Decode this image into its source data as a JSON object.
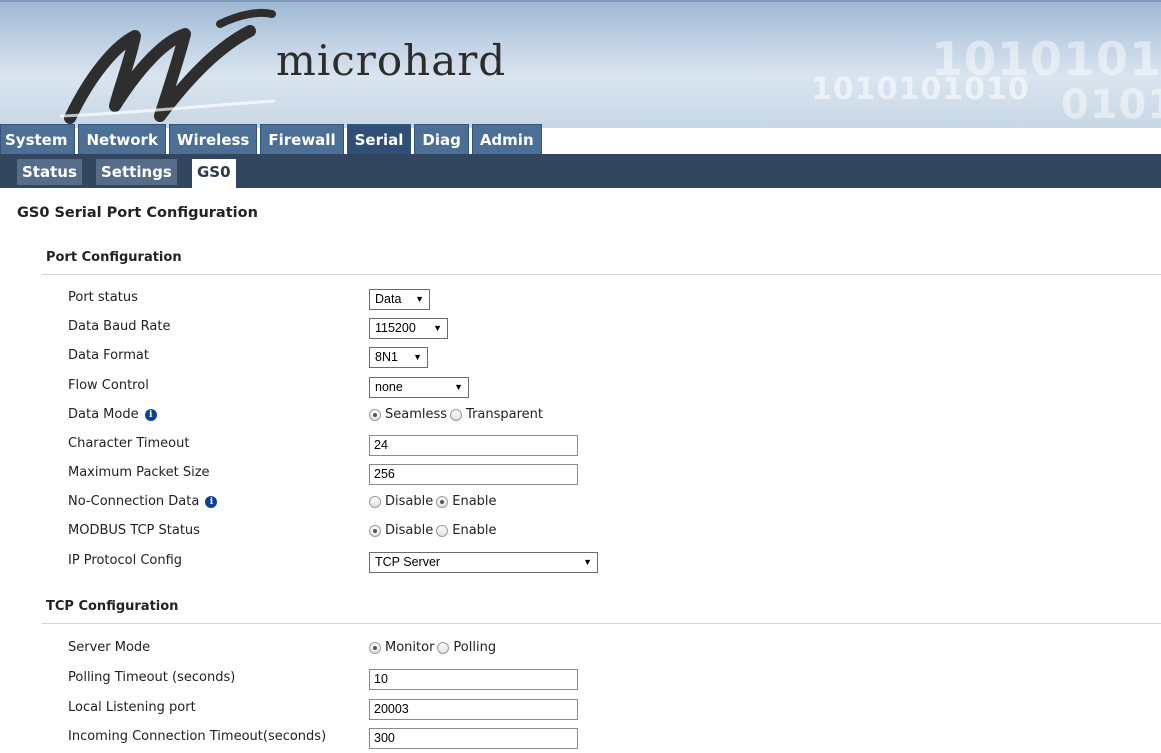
{
  "brand": {
    "name": "microhard",
    "binary_deco": [
      "1010101010",
      "1010101",
      "0101"
    ]
  },
  "main_tabs": [
    "System",
    "Network",
    "Wireless",
    "Firewall",
    "Serial",
    "Diag",
    "Admin"
  ],
  "main_tab_active": "Serial",
  "sub_tabs": [
    "Status",
    "Settings",
    "GS0"
  ],
  "sub_tab_active": "GS0",
  "page_title": "GS0 Serial Port Configuration",
  "port_config": {
    "title": "Port Configuration",
    "port_status": {
      "label": "Port status",
      "value": "Data"
    },
    "baud_rate": {
      "label": "Data Baud Rate",
      "value": "115200"
    },
    "data_format": {
      "label": "Data Format",
      "value": "8N1"
    },
    "flow_control": {
      "label": "Flow Control",
      "value": "none"
    },
    "data_mode": {
      "label": "Data Mode",
      "options": [
        "Seamless",
        "Transparent"
      ],
      "selected": "Seamless"
    },
    "char_timeout": {
      "label": "Character Timeout",
      "value": "24"
    },
    "max_packet": {
      "label": "Maximum Packet Size",
      "value": "256"
    },
    "no_conn_data": {
      "label": "No-Connection Data",
      "options": [
        "Disable",
        "Enable"
      ],
      "selected": "Enable"
    },
    "modbus": {
      "label": "MODBUS TCP Status",
      "options": [
        "Disable",
        "Enable"
      ],
      "selected": "Disable"
    },
    "ip_protocol": {
      "label": "IP Protocol Config",
      "value": "TCP Server"
    }
  },
  "tcp_config": {
    "title": "TCP Configuration",
    "server_mode": {
      "label": "Server Mode",
      "options": [
        "Monitor",
        "Polling"
      ],
      "selected": "Monitor"
    },
    "polling_timeout": {
      "label": "Polling Timeout (seconds)",
      "value": "10"
    },
    "local_port": {
      "label": "Local Listening port",
      "value": "20003"
    },
    "incoming_timeout": {
      "label": "Incoming Connection Timeout(seconds)",
      "value": "300"
    }
  },
  "colors": {
    "tab_bg": "#4b6f95",
    "tab_active": "#2f4f76",
    "subbar_bg": "#32465f",
    "info_icon": "#0d3f9c"
  },
  "icons": {
    "info": "info-icon",
    "dropdown": "chevron-down-icon",
    "logo": "microhard-logo"
  }
}
